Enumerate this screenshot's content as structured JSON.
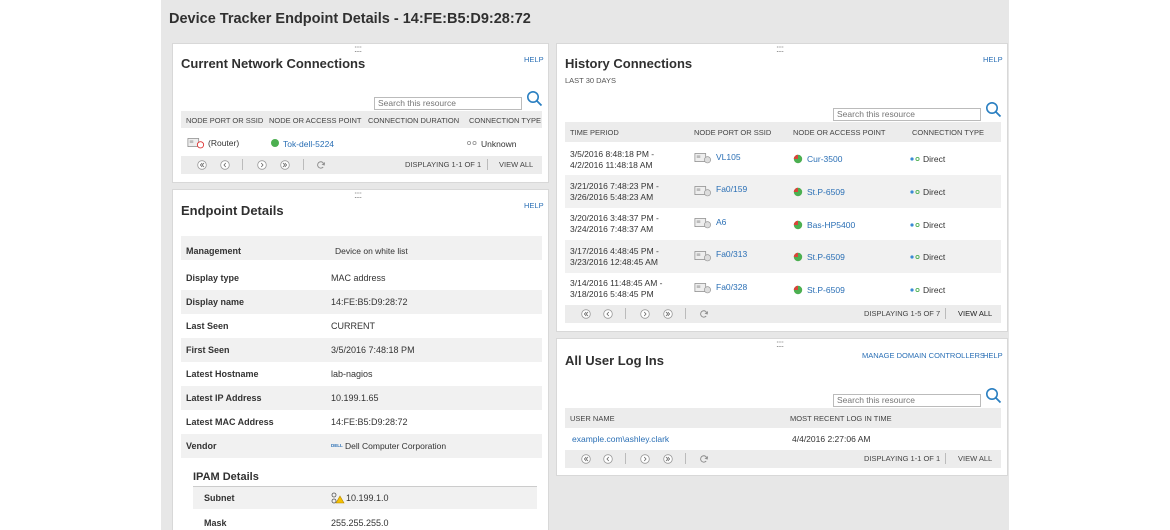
{
  "page": {
    "title": "Device Tracker Endpoint Details - 14:FE:B5:D9:28:72"
  },
  "current": {
    "title": "Current Network Connections",
    "help": "HELP",
    "search_placeholder": "Search this resource",
    "headers": [
      "NODE PORT OR SSID",
      "NODE OR ACCESS POINT",
      "CONNECTION DURATION",
      "CONNECTION TYPE"
    ],
    "row": {
      "port": "(Router)",
      "node": "Tok-dell-5224",
      "type": "Unknown"
    },
    "displaying": "DISPLAYING 1-1 OF 1",
    "view_all": "VIEW ALL"
  },
  "endpoint": {
    "title": "Endpoint Details",
    "help": "HELP",
    "rows": [
      {
        "label": "Management",
        "value": "Device on white list"
      },
      {
        "label": "Display type",
        "value": "MAC address"
      },
      {
        "label": "Display name",
        "value": "14:FE:B5:D9:28:72"
      },
      {
        "label": "Last Seen",
        "value": "CURRENT"
      },
      {
        "label": "First Seen",
        "value": "3/5/2016 7:48:18 PM"
      },
      {
        "label": "Latest Hostname",
        "value": "lab-nagios"
      },
      {
        "label": "Latest IP Address",
        "value": "10.199.1.65"
      },
      {
        "label": "Latest MAC Address",
        "value": "14:FE:B5:D9:28:72"
      },
      {
        "label": "Vendor",
        "value": "Dell Computer Corporation",
        "logo": "DELL"
      }
    ],
    "ipam": {
      "title": "IPAM Details",
      "subnet_label": "Subnet",
      "subnet_value": "10.199.1.0",
      "mask_label": "Mask",
      "mask_value": "255.255.255.0"
    }
  },
  "history": {
    "title": "History Connections",
    "subtitle": "LAST 30 DAYS",
    "help": "HELP",
    "search_placeholder": "Search this resource",
    "headers": [
      "TIME PERIOD",
      "NODE PORT OR SSID",
      "NODE OR ACCESS POINT",
      "CONNECTION TYPE"
    ],
    "rows": [
      {
        "time1": "3/5/2016 8:48:18 PM -",
        "time2": "4/2/2016 11:48:18 AM",
        "port": "VL105",
        "node": "Cur-3500",
        "type": "Direct"
      },
      {
        "time1": "3/21/2016 7:48:23 PM -",
        "time2": "3/26/2016 5:48:23 AM",
        "port": "Fa0/159",
        "node": "St.P-6509",
        "type": "Direct"
      },
      {
        "time1": "3/20/2016 3:48:37 PM -",
        "time2": "3/24/2016 7:48:37 AM",
        "port": "A6",
        "node": "Bas-HP5400",
        "type": "Direct"
      },
      {
        "time1": "3/17/2016 4:48:45 PM -",
        "time2": "3/23/2016 12:48:45 AM",
        "port": "Fa0/313",
        "node": "St.P-6509",
        "type": "Direct"
      },
      {
        "time1": "3/14/2016 11:48:45 AM -",
        "time2": "3/18/2016 5:48:45 PM",
        "port": "Fa0/328",
        "node": "St.P-6509",
        "type": "Direct"
      }
    ],
    "displaying": "DISPLAYING 1-5 OF 7",
    "view_all": "VIEW ALL"
  },
  "logins": {
    "title": "All User Log Ins",
    "manage": "MANAGE DOMAIN CONTROLLERS",
    "help": "HELP",
    "search_placeholder": "Search this resource",
    "headers": [
      "USER NAME",
      "MOST RECENT LOG IN TIME"
    ],
    "row": {
      "user": "example.com\\ashley.clark",
      "time": "4/4/2016 2:27:06 AM"
    },
    "displaying": "DISPLAYING 1-1 OF 1",
    "view_all": "VIEW ALL"
  },
  "colors": {
    "link": "#2a6fb5",
    "node_green": "#4caf50",
    "node_red": "#d9443a",
    "background": "#e7e7e7"
  }
}
